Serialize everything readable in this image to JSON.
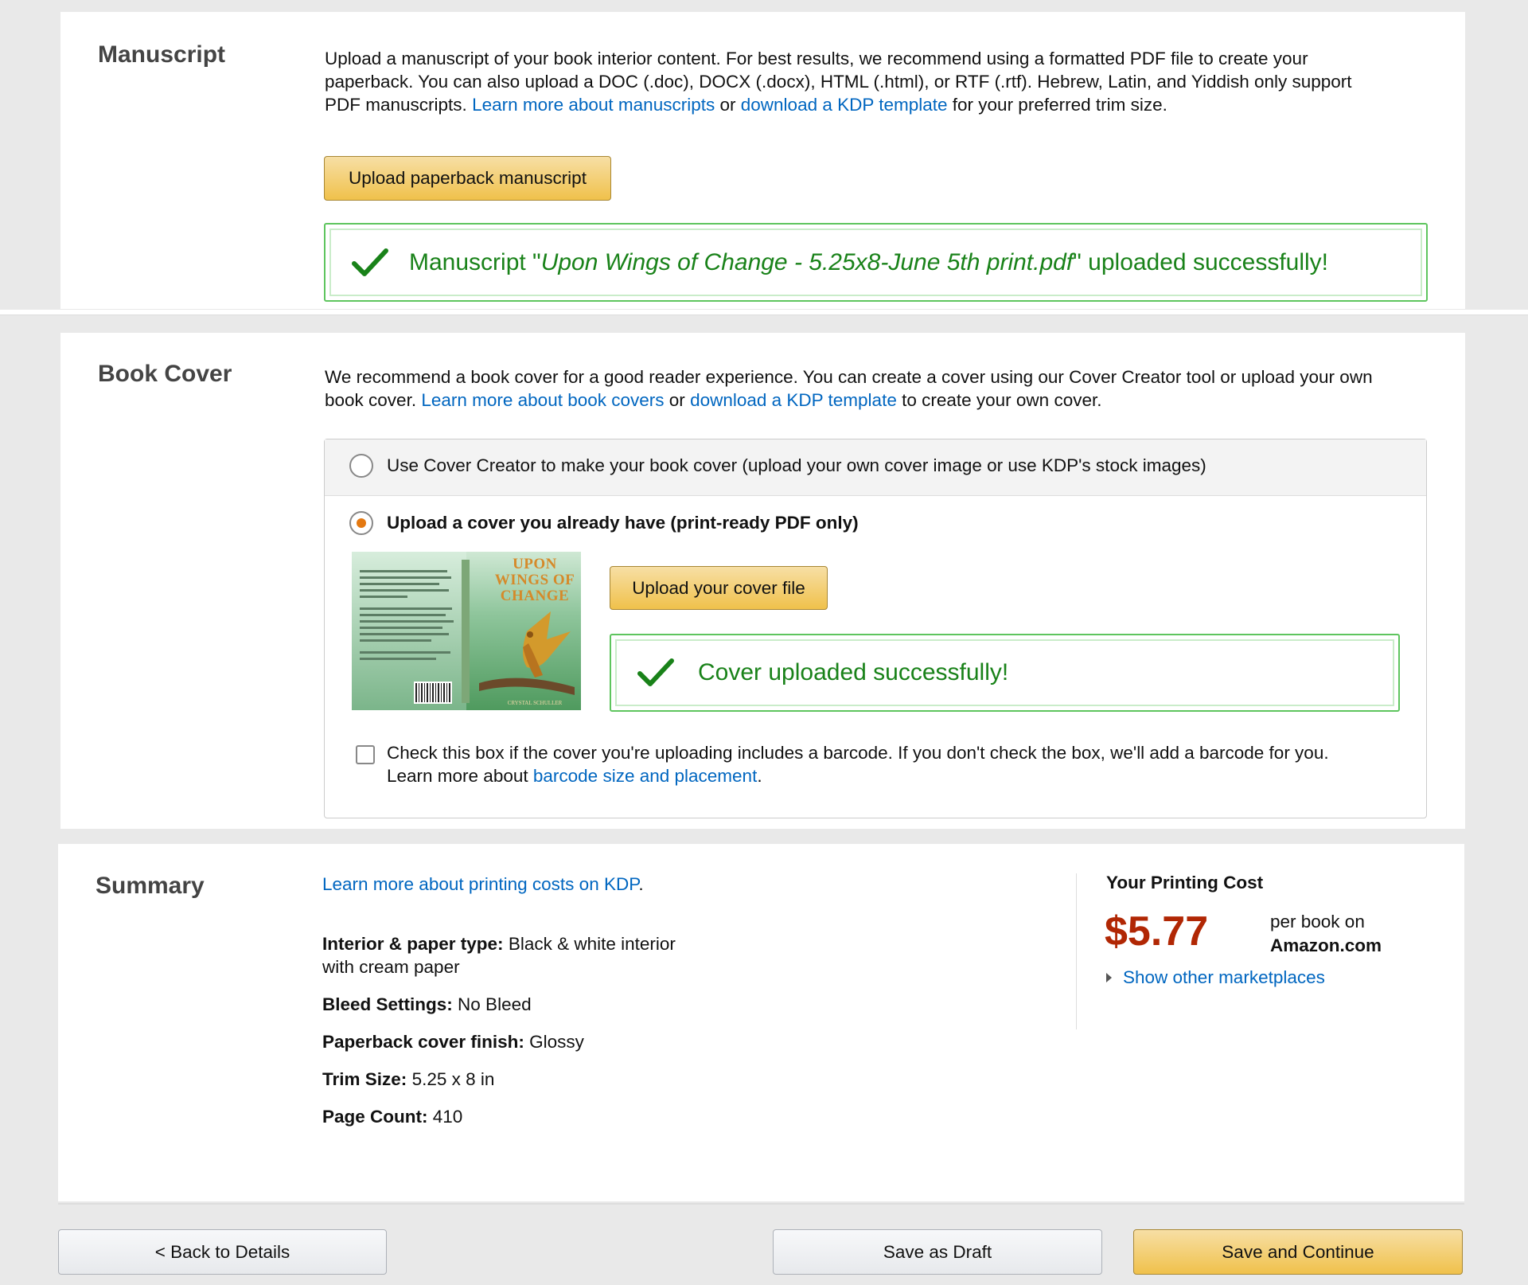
{
  "manuscript": {
    "title": "Manuscript",
    "desc_1": "Upload a manuscript of your book interior content. For best results, we recommend using a formatted PDF file to create your",
    "desc_2": "paperback. You can also upload a DOC (.doc), DOCX (.docx), HTML (.html), or RTF (.rtf). Hebrew, Latin, and Yiddish only support",
    "desc_3": "PDF manuscripts.",
    "learn_more_link": "Learn more about manuscripts",
    "or": "or",
    "template_link": "download a KDP template",
    "desc_tail": "for your preferred trim size.",
    "upload_button": "Upload paperback manuscript",
    "success_prefix": "Manuscript \"",
    "success_filename": "Upon Wings of Change - 5.25x8-June 5th print.pdf",
    "success_suffix": "\" uploaded successfully!"
  },
  "book_cover": {
    "title": "Book Cover",
    "desc_1": "We recommend a book cover for a good reader experience. You can create a cover using our Cover Creator tool or upload your own",
    "desc_2": "book cover.",
    "learn_more_link": "Learn more about book covers",
    "or": "or",
    "template_link": "download a KDP template",
    "desc_tail": "to create your own cover.",
    "option_creator": "Use Cover Creator to make your book cover (upload your own cover image or use KDP's stock images)",
    "option_upload": "Upload a cover you already have (print-ready PDF only)",
    "upload_button": "Upload your cover file",
    "success_text": "Cover uploaded successfully!",
    "barcode_text_1": "Check this box if the cover you're uploading includes a barcode. If you don't check the box, we'll add a barcode for you.",
    "barcode_text_2": "Learn more about",
    "barcode_link": "barcode size and placement",
    "barcode_period": ".",
    "thumb_title_1": "UPON",
    "thumb_title_2": "WINGS OF",
    "thumb_title_3": "CHANGE",
    "thumb_author": "CRYSTAL SCHULLER"
  },
  "summary": {
    "title": "Summary",
    "learn_link": "Learn more about printing costs on KDP",
    "learn_period": ".",
    "interior_label": "Interior & paper type:",
    "interior_value_1": "Black & white interior",
    "interior_value_2": "with cream paper",
    "bleed_label": "Bleed Settings:",
    "bleed_value": "No Bleed",
    "finish_label": "Paperback cover finish:",
    "finish_value": "Glossy",
    "trim_label": "Trim Size:",
    "trim_value": "5.25 x 8 in",
    "pages_label": "Page Count:",
    "pages_value": "410",
    "cost_heading": "Your Printing Cost",
    "cost_value": "$5.77",
    "cost_per": "per book on",
    "cost_market": "Amazon.com",
    "other_markets": "Show other marketplaces"
  },
  "footer": {
    "back": "< Back to Details",
    "draft": "Save as Draft",
    "continue": "Save and Continue"
  },
  "colors": {
    "link": "#0066c0",
    "success": "#198219",
    "price": "#b12704",
    "radio_selected": "#e47911"
  }
}
